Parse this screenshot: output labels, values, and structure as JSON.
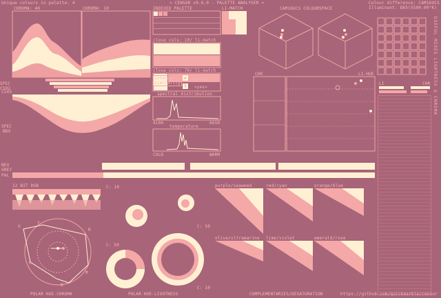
{
  "header": {
    "unique_colours": "Unique colours in palette: 4",
    "title": "= CENSOR v0.6.0 - PALETTE ANALYSER =",
    "colour_difference": "Colour difference: CAM16UCS",
    "illuminant": "Illuminant: D65(5500.00°K)"
  },
  "labels": {
    "chroma40": "CHROMA: 40",
    "chroma10": "CHROMA: 10",
    "indexed_palette": "INDEXED PALETTE",
    "li_match": "LI-MATCH",
    "cam16ucs": "CAM16UCS COLOURSPACE",
    "close_cols_1": "close cols: 10/ li-match",
    "close_cols_2": "close cols: 70/ li-match",
    "internal_similarity": "internal similarity",
    "cyclic": "cyclic?",
    "yes": "<yes>",
    "spectral_distribution": "spectral distribution",
    "spec_min": "4100",
    "spec_max": "6650",
    "temperature": "temperature",
    "cold": "COLD",
    "warm": "WARM",
    "chr": "CHR",
    "li_hue": "LI-HUE",
    "li": "LI",
    "chr2": "CHR",
    "spec_cs02": "SPEC CS02",
    "spec_cs03": "CS03",
    "spec": "SPEC",
    "spec_bdx": "BDX",
    "neu": "NEU",
    "grey": "GREY",
    "pal": "PAL",
    "bit_rgb": "12 BIT RGB",
    "c10_a": "C: 10",
    "c50_a": "C: 50",
    "c50_b": "C: 50",
    "c10_b": "C: 10",
    "purple_seaweed": "purple/seaweed",
    "red_cyan": "red/cyan",
    "orange_blue": "orange/blue",
    "olive_ultramarine": "olive/ultramarine",
    "lime_violet": "lime/violet",
    "emerald_rose": "emerald/rose",
    "polar_hue_chroma": "POLAR HUE-CHROMA",
    "polar_hue_lightness": "POLAR HUE-LIGHTNESS",
    "complementaries": "COMPLEMENTARIES/DESATURATION",
    "github": "https://github.com/quickmarble/censor",
    "side_vertical": "USEFUL MIXES   LIGHTNESS & CHROMA",
    "polar_g": "G",
    "polar_y": "Y",
    "polar_r": "R",
    "polar_m": "M",
    "polar_b": "B",
    "polar_e": "E",
    "check_mark": "✓",
    "warning_mark": "!"
  },
  "colors": {
    "bg": "#a86478",
    "pink": "#f4a8a8",
    "cream": "#fff0d4",
    "line": "#f0a6a6"
  }
}
